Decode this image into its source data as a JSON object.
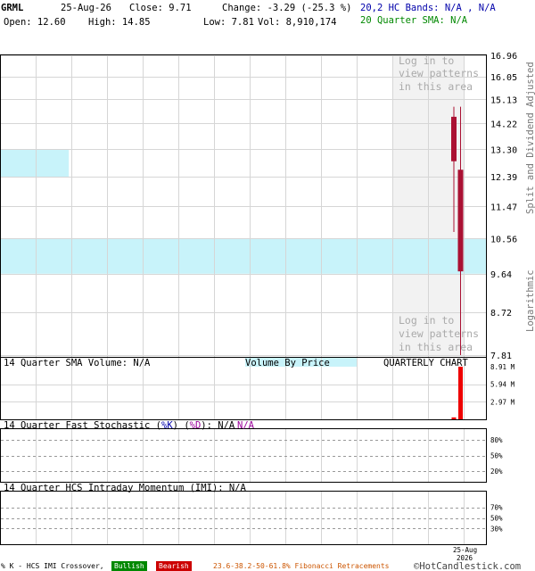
{
  "header": {
    "symbol": "GRML",
    "date": "25-Aug-26",
    "close": "Close: 9.71",
    "change": "Change: -3.29 (-25.3 %)",
    "bands": "20,2 HC Bands: N/A , N/A",
    "open": "Open: 12.60",
    "high": "High: 14.85",
    "low": "Low: 7.81",
    "vol": "Vol: 8,910,174",
    "sma": "20 Quarter SMA: N/A"
  },
  "main": {
    "side_label_top": "Split and Dividend Adjusted",
    "side_label_bottom": "Logarithmic",
    "pattern_note_top": [
      "Log in to",
      "view patterns",
      "in this area"
    ],
    "pattern_note_bottom": [
      "Log in to",
      "view patterns",
      "in this area"
    ]
  },
  "volume_panel": {
    "title": "14 Quarter SMA Volume: N/A",
    "vbp_label": "Volume By Price",
    "chart_label": "QUARTERLY CHART"
  },
  "stoch_panel": {
    "title_a": "14 Quarter Fast Stochastic (",
    "k": "%K",
    "mid": ") (",
    "d": "%D",
    "title_b": "): N/A",
    "na": "N/A"
  },
  "imi_panel": {
    "title": "14 Quarter HCS Intraday Momentum (IMI): N/A"
  },
  "footer": {
    "crossover": "% K - HCS IMI Crossover,",
    "bullish": "Bullish",
    "bearish": "Bearish",
    "fib": "23.6-38.2-50-61.8% Fibonacci Retracements",
    "copyright": "©HotCandlestick.com",
    "date_label_1": "25-Aug",
    "date_label_2": "2026"
  },
  "colors": {
    "candle": "#aa1133",
    "volume": "#ee0000",
    "vbp": "#c8f3fa",
    "pattern_area": "#f2f2f2",
    "grid": "#d6d6d6",
    "blue_text": "#0000aa",
    "green_text": "#008800",
    "purple_text": "#990099",
    "fib_text": "#cc5500"
  },
  "chart_data": [
    {
      "type": "candlestick",
      "scale": "log",
      "y_ticks": [
        16.96,
        16.05,
        15.13,
        14.22,
        13.3,
        12.39,
        11.47,
        10.56,
        9.64,
        8.72,
        7.81
      ],
      "ylim": [
        7.81,
        16.96
      ],
      "candles": [
        {
          "open": 14.45,
          "high": 14.85,
          "low": 10.74,
          "close": 12.91
        },
        {
          "open": 12.6,
          "high": 14.85,
          "low": 7.81,
          "close": 9.71
        }
      ],
      "volume_by_price": [
        {
          "low": 12.39,
          "high": 13.3,
          "rel": 0.14
        },
        {
          "low": 9.64,
          "high": 10.56,
          "rel": 1.0
        }
      ]
    },
    {
      "type": "bar",
      "name": "volume",
      "y_ticks": [
        "8.91 M",
        "5.94 M",
        "2.97 M"
      ],
      "ylim": [
        0,
        8.91
      ],
      "values": [
        0.33,
        8.91
      ]
    },
    {
      "type": "line",
      "name": "stochastic",
      "y_ticks": [
        "80%",
        "50%",
        "20%"
      ],
      "ylim": [
        0,
        100
      ]
    },
    {
      "type": "line",
      "name": "imi",
      "y_ticks": [
        "70%",
        "50%",
        "30%"
      ],
      "ylim": [
        0,
        100
      ]
    }
  ]
}
